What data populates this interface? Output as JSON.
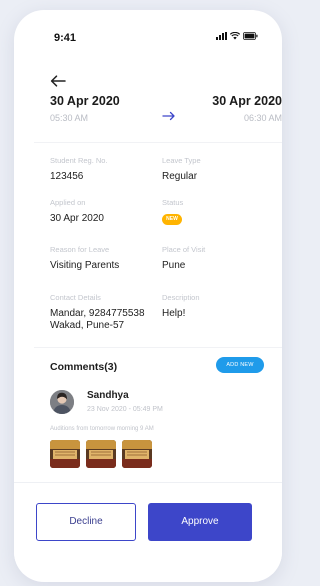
{
  "status_bar": {
    "time": "9:41"
  },
  "leave": {
    "from_date": "30 Apr 2020",
    "from_time": "05:30 AM",
    "to_date": "30 Apr 2020",
    "to_time": "06:30 AM"
  },
  "details": {
    "reg_no_label": "Student Reg. No.",
    "reg_no_value": "123456",
    "leave_type_label": "Leave Type",
    "leave_type_value": "Regular",
    "applied_on_label": "Applied on",
    "applied_on_value": "30 Apr 2020",
    "status_label": "Status",
    "status_badge": "NEW",
    "reason_label": "Reason for Leave",
    "reason_value": "Visiting Parents",
    "place_label": "Place of Visit",
    "place_value": "Pune",
    "contact_label": "Contact Details",
    "contact_value_line1": "Mandar, 9284775538",
    "contact_value_line2": "Wakad, Pune-57",
    "description_label": "Description",
    "description_value": "Help!"
  },
  "comments": {
    "title": "Comments(3)",
    "add_new_label": "ADD NEW",
    "items": [
      {
        "author": "Sandhya",
        "timestamp": "23 Nov 2020 - 05:49 PM",
        "text": "Auditions from tomorrow morning 9 AM"
      }
    ]
  },
  "actions": {
    "decline_label": "Decline",
    "approve_label": "Approve"
  },
  "colors": {
    "primary": "#3d46c9",
    "accent_blue": "#1f9bea",
    "status_badge": "#ffb400"
  }
}
